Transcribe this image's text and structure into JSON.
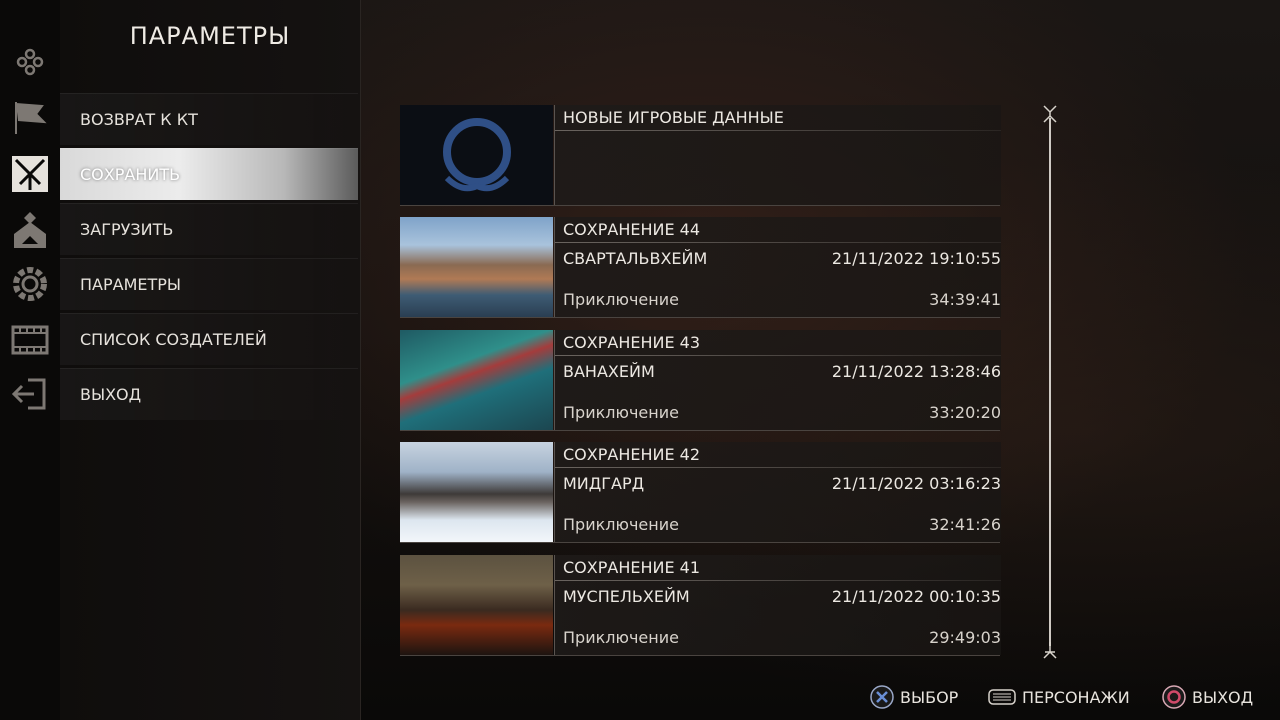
{
  "menu": {
    "title": "ПАРАМЕТРЫ",
    "items": [
      {
        "label": "ВОЗВРАТ К КТ"
      },
      {
        "label": "СОХРАНИТЬ",
        "selected": true
      },
      {
        "label": "ЗАГРУЗИТЬ"
      },
      {
        "label": "ПАРАМЕТРЫ"
      },
      {
        "label": "СПИСОК СОЗДАТЕЛЕЙ"
      },
      {
        "label": "ВЫХОД"
      }
    ]
  },
  "rail": {
    "icons": [
      "gamepad-icon",
      "flag-icon",
      "rune-icon",
      "house-icon",
      "gear-icon",
      "film-icon",
      "exit-icon"
    ],
    "active": "rune-icon"
  },
  "saves": {
    "new_slot_label": "НОВЫЕ ИГРОВЫЕ ДАННЫЕ",
    "slots": [
      {
        "title": "СОХРАНЕНИЕ 44",
        "realm": "СВАРТАЛЬВХЕЙМ",
        "date": "21/11/2022 19:10:55",
        "mode": "Приключение",
        "playtime": "34:39:41"
      },
      {
        "title": "СОХРАНЕНИЕ 43",
        "realm": "ВАНАХЕЙМ",
        "date": "21/11/2022 13:28:46",
        "mode": "Приключение",
        "playtime": "33:20:20"
      },
      {
        "title": "СОХРАНЕНИЕ 42",
        "realm": "МИДГАРД",
        "date": "21/11/2022 03:16:23",
        "mode": "Приключение",
        "playtime": "32:41:26"
      },
      {
        "title": "СОХРАНЕНИЕ 41",
        "realm": "МУСПЕЛЬХЕЙМ",
        "date": "21/11/2022 00:10:35",
        "mode": "Приключение",
        "playtime": "29:49:03"
      }
    ]
  },
  "footer": {
    "select_label": "ВЫБОР",
    "characters_label": "ПЕРСОНАЖИ",
    "exit_label": "ВЫХОД"
  },
  "colors": {
    "accent_circle": "#d04a6a",
    "accent_cross": "#6a8fd6",
    "logo_blue": "#2f4f86"
  }
}
